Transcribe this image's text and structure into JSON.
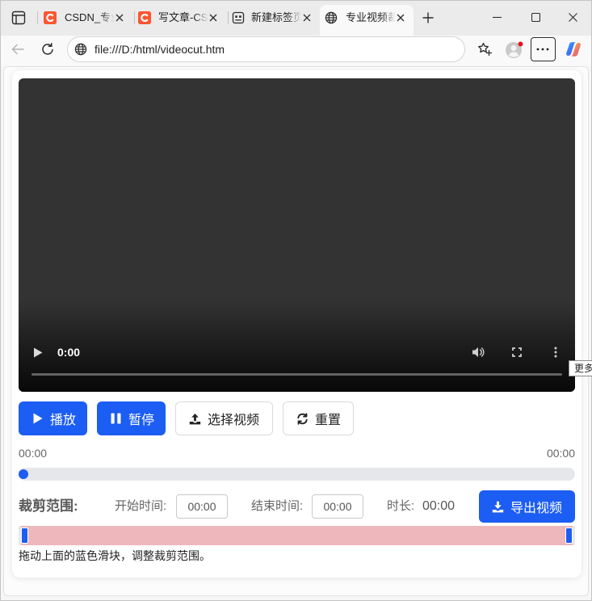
{
  "theme": {
    "accent": "#1c5df3",
    "range_fill": "#edb7bb",
    "range_track": "#e8e8e8"
  },
  "browser": {
    "tabs": [
      {
        "title": "CSDN_专业",
        "icon": "csdn-icon",
        "active": false
      },
      {
        "title": "写文章-CS",
        "icon": "csdn-icon",
        "active": false
      },
      {
        "title": "新建标签页",
        "icon": "new-tab-page-icon",
        "active": false
      },
      {
        "title": "专业视频裁",
        "icon": "globe-icon",
        "active": true
      }
    ],
    "address": {
      "url": "file:///D:/html/videocut.htm",
      "icon": "globe-icon"
    },
    "tooltip": "更多"
  },
  "video": {
    "current_time": "0:00"
  },
  "controls": {
    "play_label": "播放",
    "pause_label": "暂停",
    "select_label": "选择视频",
    "reset_label": "重置"
  },
  "timeline": {
    "current": "00:00",
    "total": "00:00",
    "progress": 0
  },
  "crop": {
    "label": "裁剪范围:",
    "start_label": "开始时间:",
    "start_value": "00:00",
    "end_label": "结束时间:",
    "end_value": "00:00",
    "duration_label": "时长:",
    "duration_value": "00:00",
    "export_label": "导出视频",
    "range_start": 0,
    "range_end": 1,
    "hint": "拖动上面的蓝色滑块，调整裁剪范围。"
  }
}
